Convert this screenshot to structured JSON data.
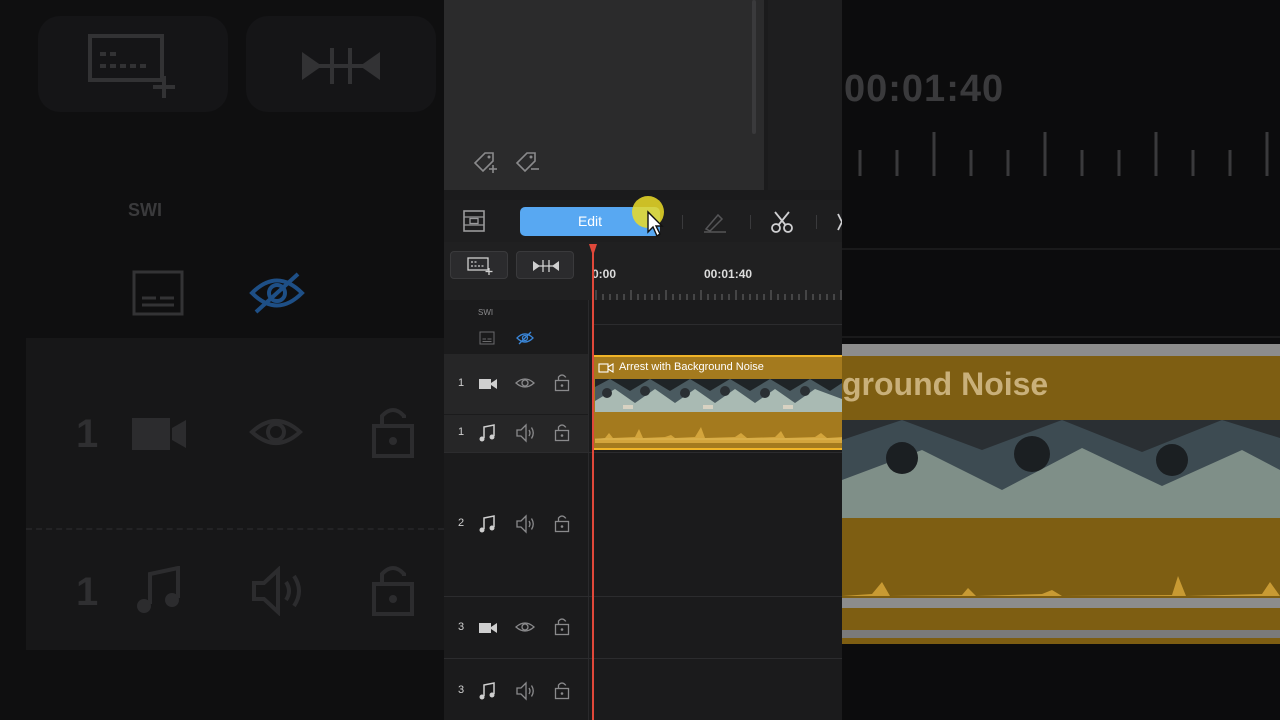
{
  "toolbar": {
    "edit_label": "Edit"
  },
  "timeline": {
    "ruler_start": "0:00",
    "ruler_mark": "00:01:40",
    "subtitle_label": "SWI"
  },
  "tracks": [
    {
      "number": "1",
      "type": "video",
      "icon": "video-camera-icon"
    },
    {
      "number": "1",
      "type": "audio",
      "icon": "music-note-icon"
    },
    {
      "number": "2",
      "type": "audio",
      "icon": "music-note-icon"
    },
    {
      "number": "3",
      "type": "video",
      "icon": "video-camera-icon"
    },
    {
      "number": "3",
      "type": "audio",
      "icon": "music-note-icon"
    }
  ],
  "clip": {
    "title": "Arrest with Background Noise",
    "color": "#a47a1e"
  },
  "background": {
    "zoom_time": "00:01:40",
    "zoom_clip_title": "ground Noise",
    "zoom_track_1": "1",
    "zoom_track_2": "1",
    "zoom_subtitle_label": "SWI"
  },
  "colors": {
    "accent": "#58a8f2",
    "playhead": "#e0483a",
    "clip_border": "#f0b428"
  }
}
